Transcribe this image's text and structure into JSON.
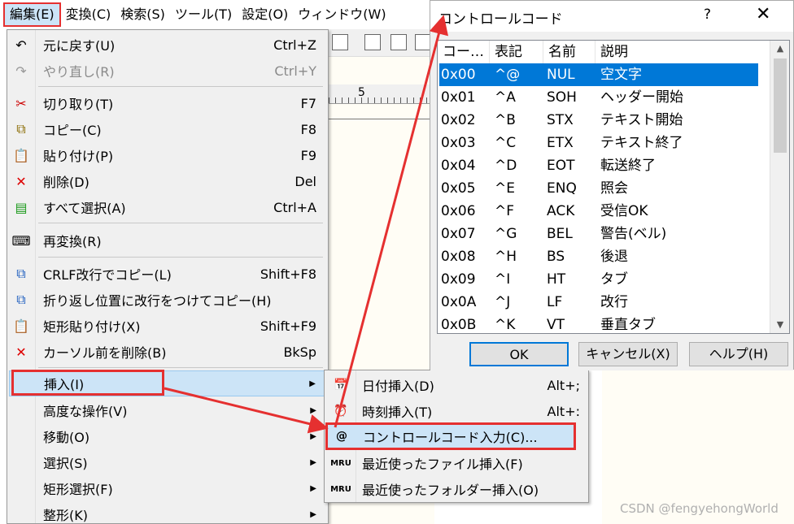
{
  "menubar": {
    "items": [
      "編集(E)",
      "変換(C)",
      "検索(S)",
      "ツール(T)",
      "設定(O)",
      "ウィンドウ(W)"
    ]
  },
  "ruler": {
    "marker": "5"
  },
  "edit_menu": {
    "items": [
      {
        "label": "元に戻す(U)",
        "shortcut": "Ctrl+Z",
        "icon": "undo-icon"
      },
      {
        "label": "やり直し(R)",
        "shortcut": "Ctrl+Y",
        "icon": "redo-icon"
      },
      {
        "label": "切り取り(T)",
        "shortcut": "F7",
        "icon": "scissors-icon"
      },
      {
        "label": "コピー(C)",
        "shortcut": "F8",
        "icon": "copy-icon"
      },
      {
        "label": "貼り付け(P)",
        "shortcut": "F9",
        "icon": "paste-icon"
      },
      {
        "label": "削除(D)",
        "shortcut": "Del",
        "icon": "delete-icon"
      },
      {
        "label": "すべて選択(A)",
        "shortcut": "Ctrl+A",
        "icon": "select-all-icon"
      },
      {
        "label": "再変換(R)",
        "shortcut": "",
        "icon": "reconvert-icon"
      },
      {
        "label": "CRLF改行でコピー(L)",
        "shortcut": "Shift+F8",
        "icon": "copy-crlf-icon"
      },
      {
        "label": "折り返し位置に改行をつけてコピー(H)",
        "shortcut": "",
        "icon": "copy-wrap-icon"
      },
      {
        "label": "矩形貼り付け(X)",
        "shortcut": "Shift+F9",
        "icon": "box-paste-icon"
      },
      {
        "label": "カーソル前を削除(B)",
        "shortcut": "BkSp",
        "icon": "backspace-icon"
      },
      {
        "label": "挿入(I)",
        "shortcut": "",
        "icon": ""
      },
      {
        "label": "高度な操作(V)",
        "shortcut": "",
        "icon": ""
      },
      {
        "label": "移動(O)",
        "shortcut": "",
        "icon": ""
      },
      {
        "label": "選択(S)",
        "shortcut": "",
        "icon": ""
      },
      {
        "label": "矩形選択(F)",
        "shortcut": "",
        "icon": ""
      },
      {
        "label": "整形(K)",
        "shortcut": "",
        "icon": ""
      }
    ]
  },
  "insert_submenu": {
    "items": [
      {
        "label": "日付挿入(D)",
        "shortcut": "Alt+;",
        "icon": "date-icon"
      },
      {
        "label": "時刻挿入(T)",
        "shortcut": "Alt+:",
        "icon": "clock-icon"
      },
      {
        "label": "コントロールコード入力(C)...",
        "shortcut": "",
        "icon": "control-code-icon"
      },
      {
        "label": "最近使ったファイル挿入(F)",
        "shortcut": "",
        "icon": "recent-file-icon"
      },
      {
        "label": "最近使ったフォルダー挿入(O)",
        "shortcut": "",
        "icon": "recent-folder-icon"
      }
    ]
  },
  "dialog": {
    "title": "コントロールコード",
    "help": "?",
    "close": "✕",
    "columns": [
      "コー…",
      "表記",
      "名前",
      "説明"
    ],
    "rows": [
      [
        "0x00",
        "^@",
        "NUL",
        "空文字"
      ],
      [
        "0x01",
        "^A",
        "SOH",
        "ヘッダー開始"
      ],
      [
        "0x02",
        "^B",
        "STX",
        "テキスト開始"
      ],
      [
        "0x03",
        "^C",
        "ETX",
        "テキスト終了"
      ],
      [
        "0x04",
        "^D",
        "EOT",
        "転送終了"
      ],
      [
        "0x05",
        "^E",
        "ENQ",
        "照会"
      ],
      [
        "0x06",
        "^F",
        "ACK",
        "受信OK"
      ],
      [
        "0x07",
        "^G",
        "BEL",
        "警告(ベル)"
      ],
      [
        "0x08",
        "^H",
        "BS",
        "後退"
      ],
      [
        "0x09",
        "^I",
        "HT",
        "タブ"
      ],
      [
        "0x0A",
        "^J",
        "LF",
        "改行"
      ],
      [
        "0x0B",
        "^K",
        "VT",
        "垂直タブ"
      ]
    ],
    "buttons": {
      "ok": "OK",
      "cancel": "キャンセル(X)",
      "help": "ヘルプ(H)"
    }
  },
  "watermark": "CSDN @fengyehongWorld",
  "colors": {
    "annotation_red": "#e53030",
    "selection_blue": "#0078d7",
    "menu_highlight": "#cce4f7"
  }
}
